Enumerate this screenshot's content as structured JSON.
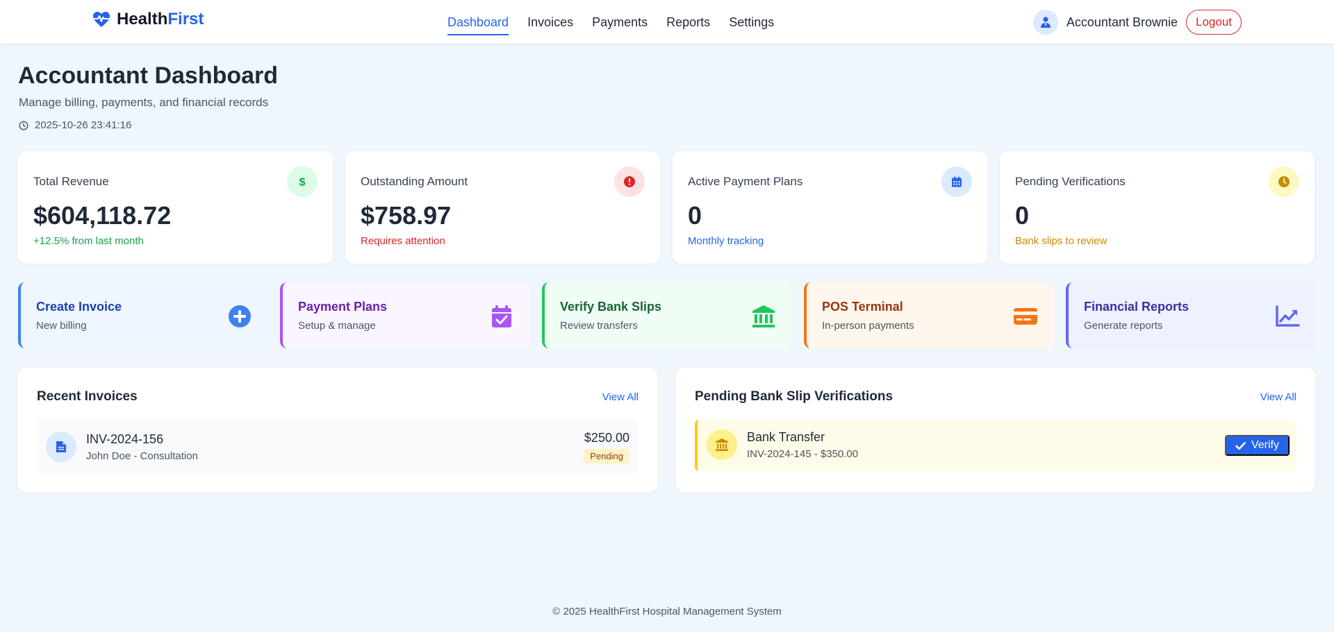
{
  "header": {
    "brand_part1": "Health",
    "brand_part2": "First",
    "nav": [
      {
        "label": "Dashboard",
        "active": true
      },
      {
        "label": "Invoices"
      },
      {
        "label": "Payments"
      },
      {
        "label": "Reports"
      },
      {
        "label": "Settings"
      }
    ],
    "user_name": "Accountant Brownie",
    "logout_label": "Logout"
  },
  "page": {
    "title": "Accountant Dashboard",
    "subtitle": "Manage billing, payments, and financial records",
    "timestamp": "2025-10-26 23:41:16"
  },
  "stats": [
    {
      "label": "Total Revenue",
      "value": "$604,118.72",
      "note": "+12.5% from last month",
      "icon": "dollar-icon",
      "note_color": "#16a34a",
      "icon_bg": "#dcfce7",
      "icon_color": "#16a34a"
    },
    {
      "label": "Outstanding Amount",
      "value": "$758.97",
      "note": "Requires attention",
      "icon": "alert-icon",
      "note_color": "#dc2626",
      "icon_bg": "#fee2e2",
      "icon_color": "#dc2626"
    },
    {
      "label": "Active Payment Plans",
      "value": "0",
      "note": "Monthly tracking",
      "icon": "calendar-icon",
      "note_color": "#2563eb",
      "icon_bg": "#dbeafe",
      "icon_color": "#2563eb"
    },
    {
      "label": "Pending Verifications",
      "value": "0",
      "note": "Bank slips to review",
      "icon": "clock-icon",
      "note_color": "#ca8a04",
      "icon_bg": "#fef9c3",
      "icon_color": "#ca8a04"
    }
  ],
  "actions": [
    {
      "title": "Create Invoice",
      "subtitle": "New billing",
      "icon": "plus-circle-icon",
      "color": "#1e40af",
      "icon_color": "#3b82f6",
      "bg": "#eff6ff",
      "border": "#3b82f6"
    },
    {
      "title": "Payment Plans",
      "subtitle": "Setup & manage",
      "icon": "calendar-check-icon",
      "color": "#6b21a8",
      "icon_color": "#a855f7",
      "bg": "#faf5ff",
      "border": "#a855f7"
    },
    {
      "title": "Verify Bank Slips",
      "subtitle": "Review transfers",
      "icon": "bank-icon",
      "color": "#166534",
      "icon_color": "#22c55e",
      "bg": "#f0fdf4",
      "border": "#22c55e"
    },
    {
      "title": "POS Terminal",
      "subtitle": "In-person payments",
      "icon": "credit-card-icon",
      "color": "#9a3412",
      "icon_color": "#f97316",
      "bg": "#fff7ed",
      "border": "#f97316"
    },
    {
      "title": "Financial Reports",
      "subtitle": "Generate reports",
      "icon": "chart-line-icon",
      "color": "#3730a3",
      "icon_color": "#6366f1",
      "bg": "#eef2ff",
      "border": "#6366f1"
    }
  ],
  "recent_invoices": {
    "title": "Recent Invoices",
    "view_all": "View All",
    "items": [
      {
        "id": "INV-2024-156",
        "description": "John Doe - Consultation",
        "amount": "$250.00",
        "status": "Pending"
      }
    ]
  },
  "bank_slips": {
    "title": "Pending Bank Slip Verifications",
    "view_all": "View All",
    "items": [
      {
        "title": "Bank Transfer",
        "description": "INV-2024-145 - $350.00",
        "action": "Verify"
      }
    ]
  },
  "footer": {
    "text": "© 2025 HealthFirst Hospital Management System"
  },
  "colors": {
    "accent": "#2563eb",
    "danger": "#dc2626",
    "background": "#eff6fc"
  }
}
